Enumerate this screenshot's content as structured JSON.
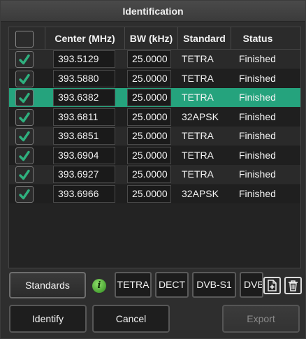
{
  "window": {
    "title": "Identification"
  },
  "table": {
    "columns": [
      "Center (MHz)",
      "BW (kHz)",
      "Standard",
      "Status"
    ],
    "rows": [
      {
        "checked": true,
        "center": "393.5129",
        "bw": "25.0000",
        "standard": "TETRA",
        "status": "Finished"
      },
      {
        "checked": true,
        "center": "393.5880",
        "bw": "25.0000",
        "standard": "TETRA",
        "status": "Finished"
      },
      {
        "checked": true,
        "center": "393.6382",
        "bw": "25.0000",
        "standard": "TETRA",
        "status": "Finished",
        "selected": true
      },
      {
        "checked": true,
        "center": "393.6811",
        "bw": "25.0000",
        "standard": "32APSK",
        "status": "Finished"
      },
      {
        "checked": true,
        "center": "393.6851",
        "bw": "25.0000",
        "standard": "TETRA",
        "status": "Finished"
      },
      {
        "checked": true,
        "center": "393.6904",
        "bw": "25.0000",
        "standard": "TETRA",
        "status": "Finished"
      },
      {
        "checked": true,
        "center": "393.6927",
        "bw": "25.0000",
        "standard": "TETRA",
        "status": "Finished"
      },
      {
        "checked": true,
        "center": "393.6966",
        "bw": "25.0000",
        "standard": "32APSK",
        "status": "Finished"
      }
    ]
  },
  "toolbar": {
    "standards_label": "Standards",
    "info_icon": "info-icon",
    "chips": [
      "TETRA",
      "DECT",
      "DVB-S1",
      "DVB"
    ],
    "add_icon": "add-document-icon",
    "delete_icon": "trash-icon"
  },
  "actions": {
    "identify_label": "Identify",
    "cancel_label": "Cancel",
    "export_label": "Export"
  },
  "colors": {
    "accent": "#25a37d",
    "check": "#2fb07e"
  }
}
